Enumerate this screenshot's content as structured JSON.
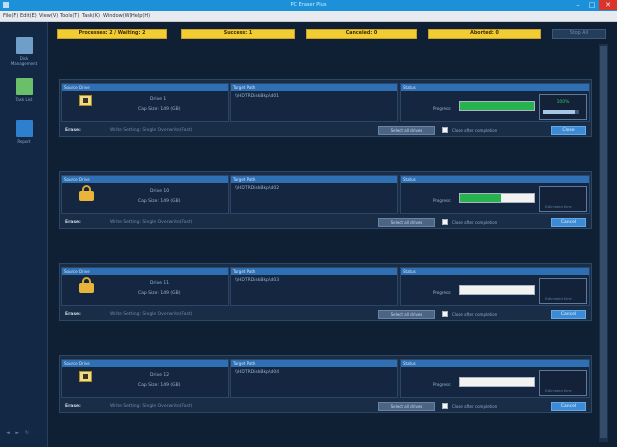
{
  "window": {
    "title": "PC Eraser Plus",
    "min_glyph": "–",
    "max_glyph": "□",
    "close_glyph": "✕"
  },
  "menu": [
    "File(F)",
    "Edit(E)",
    "View(V)",
    "Tools(T)",
    "Task(K)",
    "Window(W)",
    "Help(H)"
  ],
  "sidebar": {
    "items": [
      {
        "label": "Disk Management",
        "icon": "disk-management-icon",
        "color": "#6f9fc9"
      },
      {
        "label": "Task List",
        "icon": "task-list-icon",
        "color": "#6ac06a"
      },
      {
        "label": "Report",
        "icon": "report-icon",
        "color": "#2f7fcf"
      }
    ],
    "footer": "◄ ► ↻"
  },
  "status_bar": {
    "processes": "Processes: 2 / Waiting: 2",
    "success": "Success: 1",
    "canceled": "Canceled: 0",
    "aborted": "Aborted: 0",
    "stop_all": "Stop All"
  },
  "colors": {
    "accent": "#2f6fb4",
    "yellow": "#f1cc33",
    "progress": "#28b24f"
  },
  "tasks": [
    {
      "icon": "disk-icon",
      "source_header": "Source Drive",
      "target_header": "Target Path",
      "status_header": "Status",
      "src_line1": "Drive 1",
      "src_line2": "Cap Size: 149 (GB)",
      "target": "\\\\HDTRDiskBkp\\d01",
      "progress_label": "Progress:",
      "progress": 1.0,
      "mini_pct": "100%",
      "mini_track": 0.9,
      "mini_label": "",
      "erase_label": "Erase:",
      "erase_mode": "Write Setting: Single Overwrite(Fast)",
      "select_label": "Select all drives",
      "check_label": "Close after completion",
      "btn": "Close"
    },
    {
      "icon": "lock-icon",
      "source_header": "Source Drive",
      "target_header": "Target Path",
      "status_header": "Status",
      "src_line1": "Drive 10",
      "src_line2": "Cap Size: 149 (GB)",
      "target": "\\\\HDTRDiskBkp\\d02",
      "progress_label": "Progress:",
      "progress": 0.55,
      "mini_pct": "",
      "mini_track": 0,
      "mini_label": "Estimated time",
      "erase_label": "Erase:",
      "erase_mode": "Write Setting: Single Overwrite(Fast)",
      "select_label": "Select all drives",
      "check_label": "Close after completion",
      "btn": "Cancel"
    },
    {
      "icon": "lock-icon",
      "source_header": "Source Drive",
      "target_header": "Target Path",
      "status_header": "Status",
      "src_line1": "Drive 11",
      "src_line2": "Cap Size: 149 (GB)",
      "target": "\\\\HDTRDiskBkp\\d03",
      "progress_label": "Progress:",
      "progress": 0.0,
      "mini_pct": "",
      "mini_track": 0,
      "mini_label": "Estimated time",
      "erase_label": "Erase:",
      "erase_mode": "Write Setting: Single Overwrite(Fast)",
      "select_label": "Select all drives",
      "check_label": "Close after completion",
      "btn": "Cancel"
    },
    {
      "icon": "disk-icon",
      "source_header": "Source Drive",
      "target_header": "Target Path",
      "status_header": "Status",
      "src_line1": "Drive 12",
      "src_line2": "Cap Size: 149 (GB)",
      "target": "\\\\HDTRDiskBkp\\d04",
      "progress_label": "Progress:",
      "progress": 0.0,
      "mini_pct": "",
      "mini_track": 0,
      "mini_label": "Estimated time",
      "erase_label": "Erase:",
      "erase_mode": "Write Setting: Single Overwrite(Fast)",
      "select_label": "Select all drives",
      "check_label": "Close after completion",
      "btn": "Cancel"
    }
  ]
}
